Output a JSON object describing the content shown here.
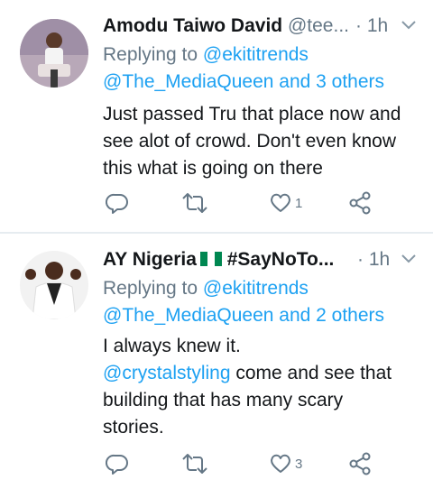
{
  "tweets": [
    {
      "name": "Amodu Taiwo David",
      "handle": "@tee...",
      "time": "· 1h",
      "replying_prefix": "Replying to",
      "replying_to": "@ekititrends",
      "replying_more": "@The_MediaQueen and 3 others",
      "body_lines": [
        "Just passed Tru that place now and",
        "see alot of crowd. Don't even know",
        "this what is going on there"
      ],
      "like_count": "1"
    },
    {
      "name": "AY Nigeria",
      "handle_hashtag": "#SayNoTo...",
      "time": "· 1h",
      "replying_prefix": "Replying to",
      "replying_to": "@ekititrends",
      "replying_more": "@The_MediaQueen and 2 others",
      "body_line1": "I always knew it.",
      "mention": "@crystalstyling",
      "body_line2_rest": " come and see that",
      "body_line3": "building that has many scary",
      "body_line4": "stories.",
      "like_count": "3"
    }
  ],
  "colors": {
    "link": "#1da1f2",
    "muted": "#657786",
    "flag_green": "#008751"
  },
  "icons": [
    "reply-icon",
    "retweet-icon",
    "like-icon",
    "share-icon",
    "chevron-down-icon"
  ]
}
